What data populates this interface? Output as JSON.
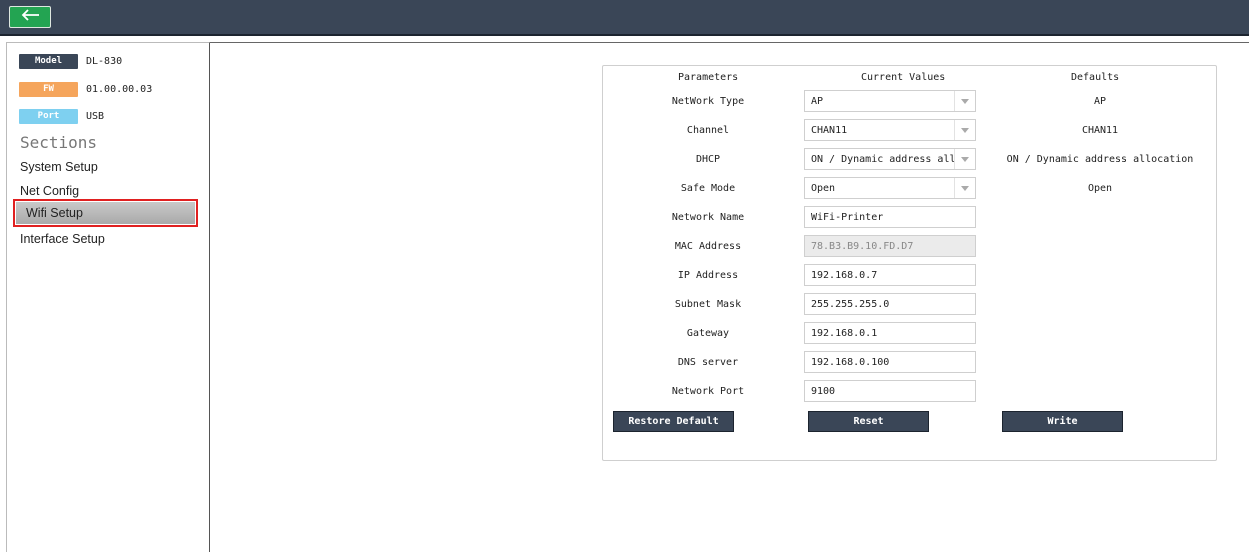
{
  "header": {
    "back_icon": "arrow-left-icon"
  },
  "device_info": {
    "model_tag": "Model",
    "model_value": "DL-830",
    "fw_tag": "FW",
    "fw_value": "01.00.00.03",
    "port_tag": "Port",
    "port_value": "USB"
  },
  "sidebar": {
    "sections_title": "Sections",
    "items": [
      {
        "label": "System Setup"
      },
      {
        "label": "Net Config"
      },
      {
        "label": "Wifi Setup"
      },
      {
        "label": "Interface Setup"
      }
    ]
  },
  "form": {
    "headers": {
      "parameters": "Parameters",
      "current": "Current Values",
      "defaults": "Defaults"
    },
    "rows": [
      {
        "label": "NetWork Type",
        "value": "AP",
        "default": "AP"
      },
      {
        "label": "Channel",
        "value": "CHAN11",
        "default": "CHAN11"
      },
      {
        "label": "DHCP",
        "value": "ON / Dynamic address allo",
        "default": "ON / Dynamic address allocation"
      },
      {
        "label": "Safe Mode",
        "value": "Open",
        "default": "Open"
      },
      {
        "label": "Network Name",
        "value": "WiFi-Printer"
      },
      {
        "label": "MAC Address",
        "value": "78.B3.B9.10.FD.D7"
      },
      {
        "label": "IP Address",
        "value": "192.168.0.7"
      },
      {
        "label": "Subnet Mask",
        "value": "255.255.255.0"
      },
      {
        "label": "Gateway",
        "value": "192.168.0.1"
      },
      {
        "label": "DNS server",
        "value": "192.168.0.100"
      },
      {
        "label": "Network Port",
        "value": "9100"
      }
    ],
    "buttons": {
      "restore": "Restore Default",
      "reset": "Reset",
      "write": "Write"
    }
  },
  "colors": {
    "topbar": "#3a4657",
    "back_button": "#23a452",
    "model_tag": "#3a4657",
    "fw_tag": "#f5a55c",
    "port_tag": "#7ed0f0",
    "highlight": "#e02020"
  }
}
